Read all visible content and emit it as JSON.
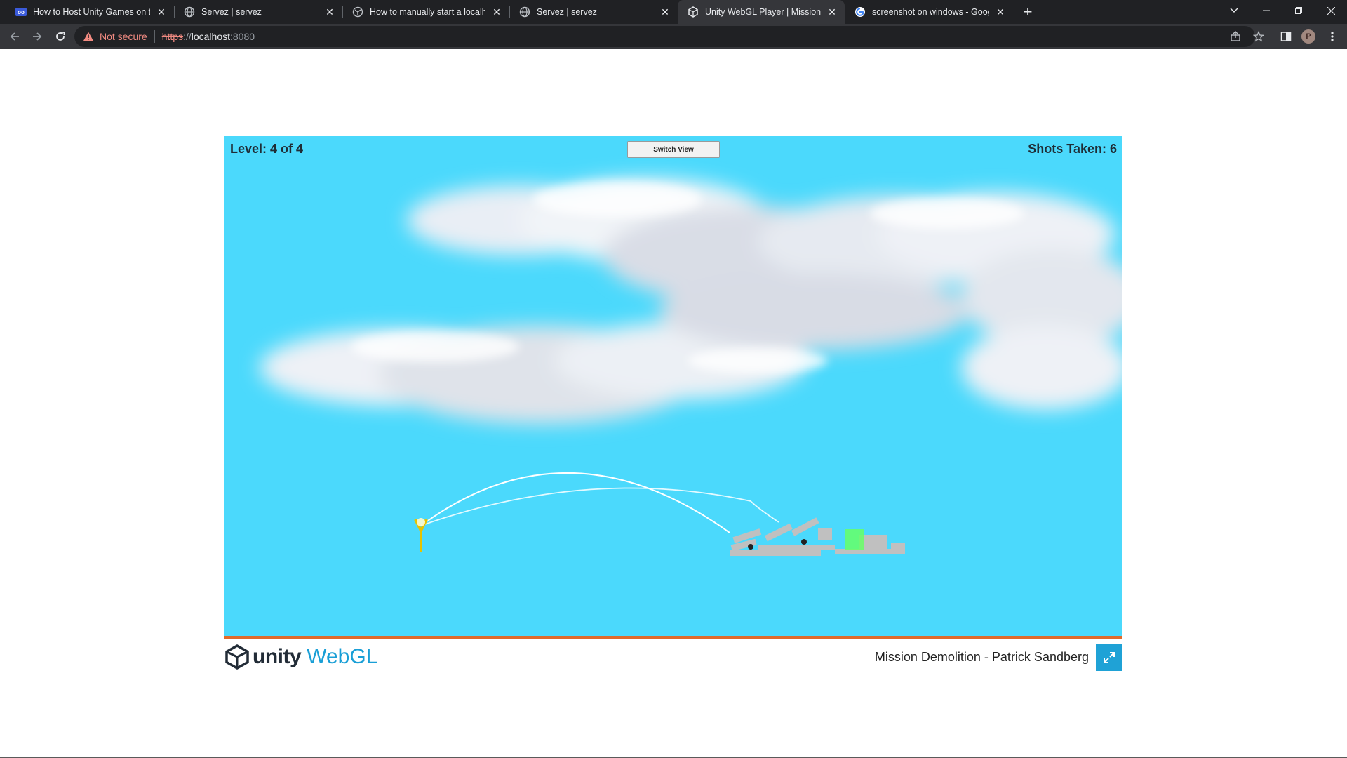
{
  "browser": {
    "tabs": [
      {
        "title": "How to Host Unity Games on the",
        "icon": "codepen-icon",
        "active": false
      },
      {
        "title": "Servez | servez",
        "icon": "globe-icon",
        "active": false
      },
      {
        "title": "How to manually start a localhost",
        "icon": "network-icon",
        "active": false
      },
      {
        "title": "Servez | servez",
        "icon": "globe-icon",
        "active": false
      },
      {
        "title": "Unity WebGL Player | Mission De",
        "icon": "unity-icon",
        "active": true
      },
      {
        "title": "screenshot on windows - Google",
        "icon": "google-icon",
        "active": false
      }
    ],
    "address": {
      "security_label": "Not secure",
      "scheme": "https",
      "separator": "://",
      "host": "localhost",
      "port": ":8080"
    },
    "profile_initial": "P"
  },
  "game": {
    "level_text": "Level: 4 of 4",
    "shots_text": "Shots Taken: 6",
    "switch_view_label": "Switch View",
    "colors": {
      "sky": "#4bd9fc",
      "ground": "#e06a2a",
      "goal": "#66ff66",
      "structure": "#c0c0c0"
    }
  },
  "footer": {
    "logo_unity": "unity",
    "logo_webgl": "WebGL",
    "credit": "Mission Demolition - Patrick Sandberg"
  }
}
